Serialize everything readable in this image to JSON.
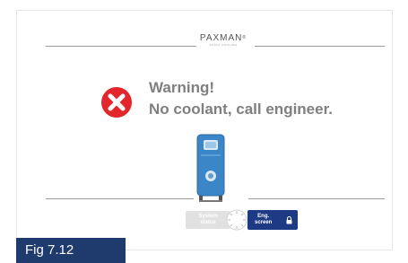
{
  "logo": {
    "brand": "PAXMAN",
    "mark": "®",
    "tagline": "scalp cooling"
  },
  "warning": {
    "icon": "error-x-icon",
    "title": "Warning!",
    "message": "No coolant, call engineer.",
    "color": "#e2262c"
  },
  "device": {
    "icon": "cooling-unit-icon",
    "color": "#3b86c6"
  },
  "controls": {
    "system_status": {
      "line1": "System",
      "line2": "status"
    },
    "dial_icon": "dial-icon",
    "eng_screen": {
      "line1": "Eng.",
      "line2": "screen",
      "icon": "lock-icon",
      "color": "#1e3a84"
    }
  },
  "figure_label": "Fig 7.12",
  "figure_label_color": "#1f3b6e"
}
